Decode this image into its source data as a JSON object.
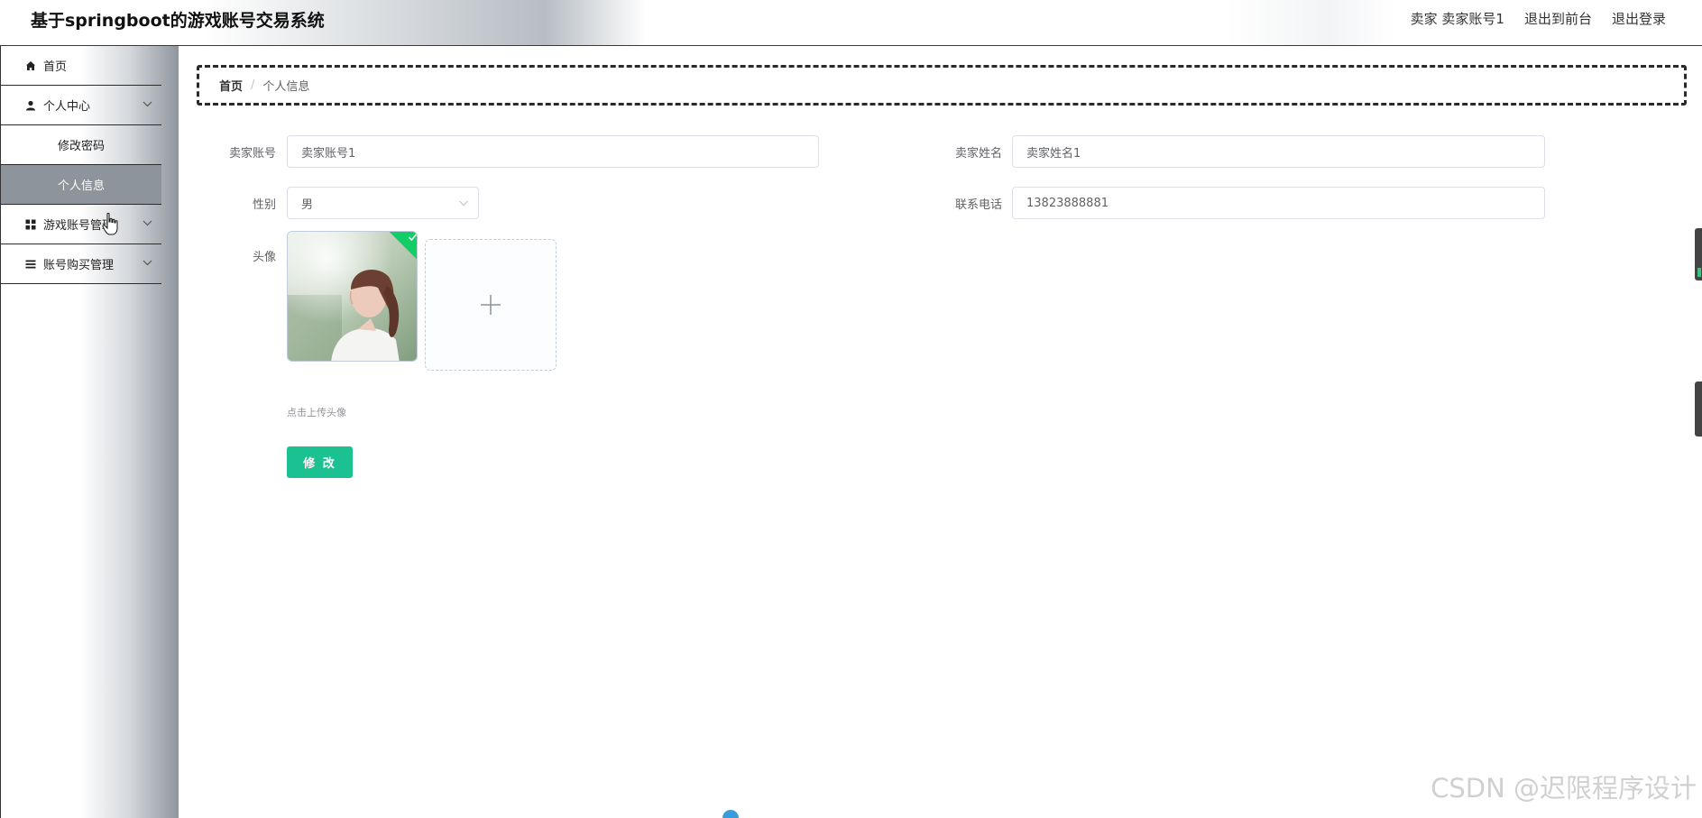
{
  "header": {
    "title": "基于springboot的游戏账号交易系统",
    "role": "卖家",
    "username": "卖家账号1",
    "front_link": "退出到前台",
    "logout_link": "退出登录"
  },
  "sidebar": {
    "items": [
      {
        "label": "首页",
        "icon": "home-icon"
      },
      {
        "label": "个人中心",
        "icon": "user-icon",
        "expanded": true,
        "children": [
          {
            "label": "修改密码"
          },
          {
            "label": "个人信息",
            "active": true
          }
        ]
      },
      {
        "label": "游戏账号管理",
        "icon": "grid-icon"
      },
      {
        "label": "账号购买管理",
        "icon": "list-icon"
      }
    ]
  },
  "breadcrumb": {
    "home": "首页",
    "separator": "/",
    "current": "个人信息"
  },
  "form": {
    "seller_account_label": "卖家账号",
    "seller_account_value": "卖家账号1",
    "seller_name_label": "卖家姓名",
    "seller_name_value": "卖家姓名1",
    "gender_label": "性别",
    "gender_value": "男",
    "phone_label": "联系电话",
    "phone_value": "13823888881",
    "avatar_label": "头像",
    "avatar_hint": "点击上传头像",
    "submit_label": "修 改"
  },
  "colors": {
    "primary_button": "#1bc191",
    "upload_success": "#13ce66",
    "active_menu": "#8d949b"
  },
  "watermark": "CSDN @迟限程序设计"
}
